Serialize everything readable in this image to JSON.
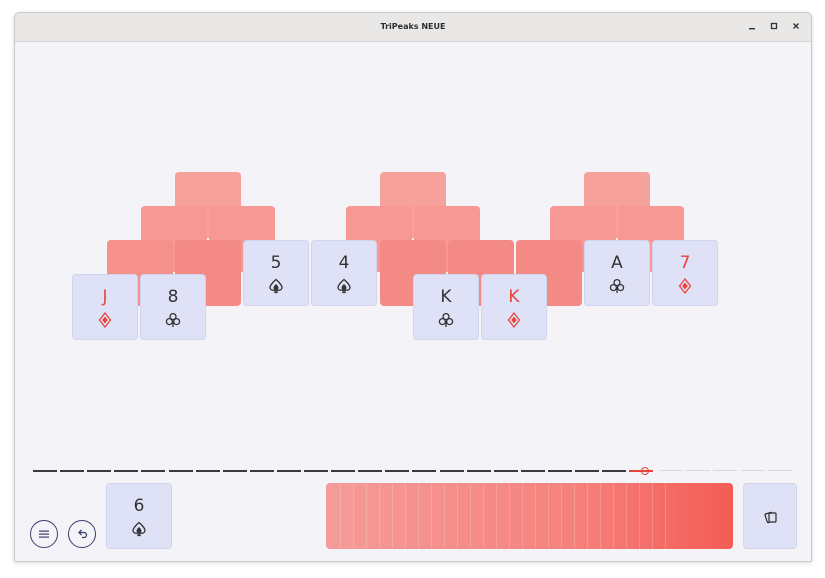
{
  "window": {
    "title": "TriPeaks NEUE"
  },
  "colors": {
    "accent_red": "#e8443b",
    "card_face": "#dfe2f6",
    "card_back": "#f7a19c",
    "text_dark": "#333333"
  },
  "tableau_face_cards": [
    {
      "rank": "J",
      "suit": "diamond-icon",
      "color": "red"
    },
    {
      "rank": "8",
      "suit": "club-icon",
      "color": "black"
    },
    {
      "rank": "5",
      "suit": "spade-icon",
      "color": "black"
    },
    {
      "rank": "4",
      "suit": "spade-icon",
      "color": "black"
    },
    {
      "rank": "K",
      "suit": "club-icon",
      "color": "black"
    },
    {
      "rank": "K",
      "suit": "diamond-icon",
      "color": "red"
    },
    {
      "rank": "A",
      "suit": "club-icon",
      "color": "black"
    },
    {
      "rank": "7",
      "suit": "diamond-icon",
      "color": "red"
    }
  ],
  "waste_card": {
    "rank": "6",
    "suit": "spade-icon",
    "color": "black"
  },
  "streak_progress": {
    "completed": 22,
    "current": 1,
    "remaining": 5
  },
  "controls": {
    "menu": "menu-icon",
    "undo": "undo-icon",
    "draw": "draw-cards-icon"
  }
}
